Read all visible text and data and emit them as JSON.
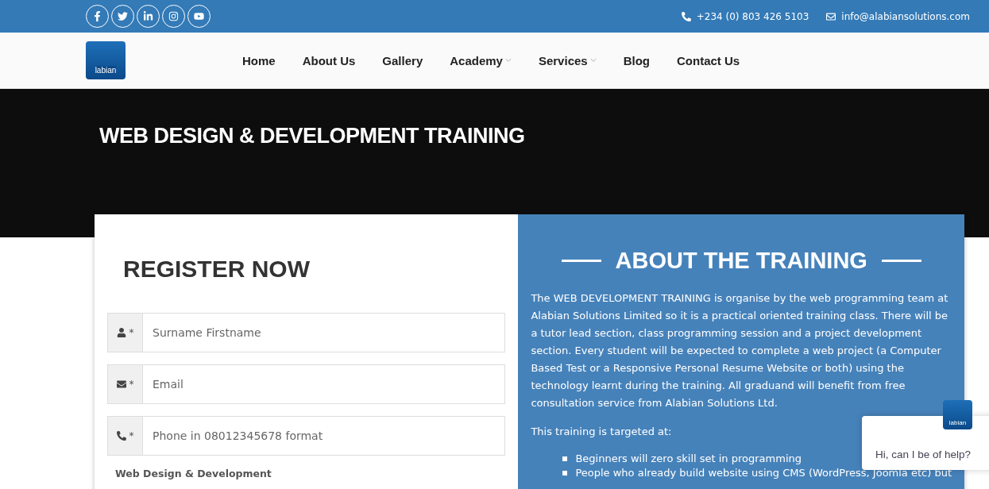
{
  "top_bar": {
    "socials": [
      {
        "kind": "facebook"
      },
      {
        "kind": "twitter"
      },
      {
        "kind": "linkedin"
      },
      {
        "kind": "instagram"
      },
      {
        "kind": "youtube"
      }
    ],
    "phone": "+234 (0) 803 426 5103",
    "email": "info@alabiansolutions.com"
  },
  "nav": {
    "logo": "labian",
    "items": [
      {
        "label": "Home",
        "dropdown": false
      },
      {
        "label": "About Us",
        "dropdown": false
      },
      {
        "label": "Gallery",
        "dropdown": false
      },
      {
        "label": "Academy",
        "dropdown": true
      },
      {
        "label": "Services",
        "dropdown": true
      },
      {
        "label": "Blog",
        "dropdown": false
      },
      {
        "label": "Contact Us",
        "dropdown": false
      }
    ]
  },
  "hero": {
    "title": "WEB DESIGN & DEVELOPMENT TRAINING"
  },
  "register": {
    "title": "REGISTER NOW",
    "fields": [
      {
        "kind": "person",
        "required": "*",
        "placeholder": "Surname Firstname"
      },
      {
        "kind": "email",
        "required": "*",
        "placeholder": "Email"
      },
      {
        "kind": "phone",
        "required": "*",
        "placeholder": "Phone in 08012345678 format"
      }
    ],
    "course": "Web Design & Development"
  },
  "about": {
    "title": "ABOUT THE TRAINING",
    "paragraphs": [
      "The WEB DEVELOPMENT TRAINING is organise by the web programming team at Alabian Solutions Limited so it is a practical oriented training class. There will be a tutor lead section, class programming session and a project development section. Every student will be expected to complete a web project (a Computer Based Test or a Responsive Personal Resume Website or both) using the technology learnt during the training. All graduand will benefit from free consultation service from Alabian Solutions Ltd.",
      "This training is targeted at:"
    ],
    "bullets": [
      "Beginners will zero skill set in programming",
      "People who already build website using CMS (WordPress, Joomla etc) but"
    ]
  },
  "chat": {
    "logo": "labian",
    "message": "Hi, can I be of help?"
  }
}
